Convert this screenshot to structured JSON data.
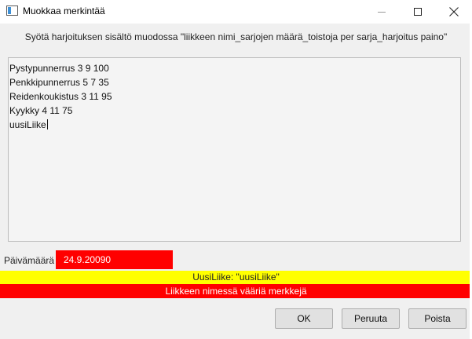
{
  "window": {
    "title": "Muokkaa merkintää",
    "icon": "window-app-icon"
  },
  "instruction": "Syötä harjoituksen sisältö muodossa \"liikkeen nimi_sarjojen määrä_toistoja per sarja_harjoitus paino\"",
  "editor": {
    "lines": [
      "Pystypunnerrus 3 9 100",
      "Penkkipunnerrus 5 7 35",
      "Reidenkoukistus 3 11 95",
      "Kyykky 4 11 75",
      "uusiLiike"
    ]
  },
  "date": {
    "label": "Päivämäärä",
    "value": "24.9.20090"
  },
  "status": {
    "info": "UusiLiike: \"uusiLiike\"",
    "error": "Liikkeen nimessä vääriä merkkejä"
  },
  "buttons": {
    "ok": "OK",
    "cancel": "Peruuta",
    "delete": "Poista"
  },
  "colors": {
    "error_bg": "#ff0000",
    "warning_bg": "#ffff00"
  }
}
